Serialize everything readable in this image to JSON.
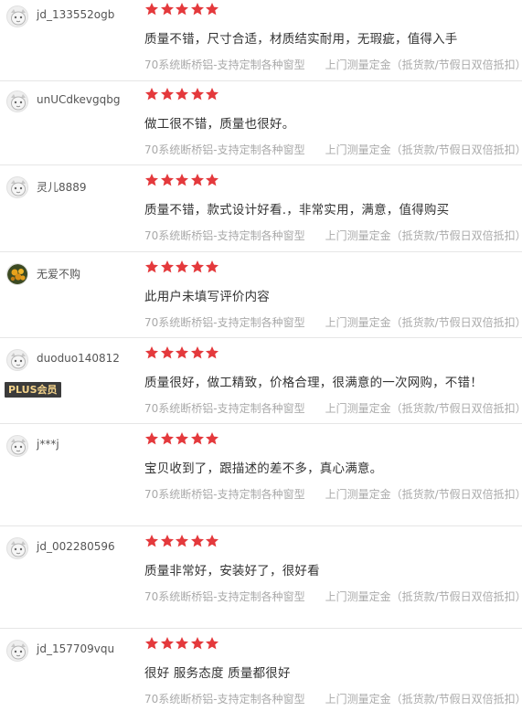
{
  "accent_color": "#e4393c",
  "reviews": [
    {
      "username": "jd_133552ogb",
      "avatar": "default-avatar",
      "plus": "",
      "rating": 5,
      "content": "质量不错，尺寸合适，材质结实耐用，无瑕疵，值得入手",
      "spec": "70系统断桥铝-支持定制各种窗型",
      "service": "上门测量定金（抵货款/节假日双倍抵扣）"
    },
    {
      "username": "unUCdkevgqbg",
      "avatar": "default-avatar",
      "plus": "",
      "rating": 5,
      "content": "做工很不错，质量也很好。",
      "spec": "70系统断桥铝-支持定制各种窗型",
      "service": "上门测量定金（抵货款/节假日双倍抵扣）"
    },
    {
      "username": "灵儿8889",
      "avatar": "default-avatar",
      "plus": "",
      "rating": 5,
      "content": "质量不错，款式设计好看.，非常实用，满意，值得购买",
      "spec": "70系统断桥铝-支持定制各种窗型",
      "service": "上门测量定金（抵货款/节假日双倍抵扣）"
    },
    {
      "username": "无爱不购",
      "avatar": "flower-avatar",
      "plus": "",
      "rating": 5,
      "content": "此用户未填写评价内容",
      "spec": "70系统断桥铝-支持定制各种窗型",
      "service": "上门测量定金（抵货款/节假日双倍抵扣）"
    },
    {
      "username": "duoduo140812",
      "avatar": "default-avatar",
      "plus": "PLUS会员",
      "rating": 5,
      "content": "质量很好，做工精致，价格合理，很满意的一次网购，不错！",
      "spec": "70系统断桥铝-支持定制各种窗型",
      "service": "上门测量定金（抵货款/节假日双倍抵扣）"
    },
    {
      "username": "j***j",
      "avatar": "default-avatar",
      "plus": "",
      "rating": 5,
      "content": "宝贝收到了，跟描述的差不多，真心满意。",
      "spec": "70系统断桥铝-支持定制各种窗型",
      "service": "上门测量定金（抵货款/节假日双倍抵扣）"
    },
    {
      "username": "jd_002280596",
      "avatar": "default-avatar",
      "plus": "",
      "rating": 5,
      "content": "质量非常好，安装好了，很好看",
      "spec": "70系统断桥铝-支持定制各种窗型",
      "service": "上门测量定金（抵货款/节假日双倍抵扣）"
    },
    {
      "username": "jd_157709vqu",
      "avatar": "default-avatar",
      "plus": "",
      "rating": 5,
      "content": "很好 服务态度 质量都很好",
      "spec": "70系统断桥铝-支持定制各种窗型",
      "service": "上门测量定金（抵货款/节假日双倍抵扣）"
    }
  ]
}
